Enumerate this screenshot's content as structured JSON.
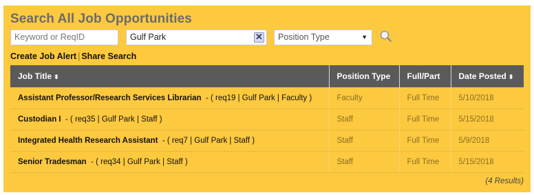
{
  "header": {
    "title": "Search All Job Opportunities"
  },
  "search": {
    "keyword_placeholder": "Keyword or ReqID",
    "location_value": "Gulf Park",
    "clear_symbol": "✕",
    "position_type_selected": "Position Type",
    "search_icon": "magnifier-icon"
  },
  "links": {
    "create_alert": "Create Job Alert",
    "separator": "|",
    "share_search": "Share Search"
  },
  "table": {
    "columns": {
      "job_title": "Job Title",
      "position_type": "Position Type",
      "full_part": "Full/Part",
      "date_posted": "Date Posted",
      "sort_symbol": "⬍"
    },
    "rows": [
      {
        "title": "Assistant Professor/Research Services Librarian",
        "meta": "- ( req19 | Gulf Park | Faculty )",
        "position_type": "Faculty",
        "full_part": "Full Time",
        "date_posted": "5/10/2018"
      },
      {
        "title": "Custodian I",
        "meta": "- ( req35 | Gulf Park | Staff )",
        "position_type": "Staff",
        "full_part": "Full Time",
        "date_posted": "5/15/2018"
      },
      {
        "title": "Integrated Health Research Assistant",
        "meta": "- ( req7 | Gulf Park | Staff )",
        "position_type": "Staff",
        "full_part": "Full Time",
        "date_posted": "5/9/2018"
      },
      {
        "title": "Senior Tradesman",
        "meta": "- ( req34 | Gulf Park | Staff )",
        "position_type": "Staff",
        "full_part": "Full Time",
        "date_posted": "5/15/2018"
      }
    ]
  },
  "results_text": "(4 Results)",
  "colors": {
    "panel": "#fdc93f",
    "header_bg": "#5a5a5a",
    "title": "#6b6b6b"
  }
}
